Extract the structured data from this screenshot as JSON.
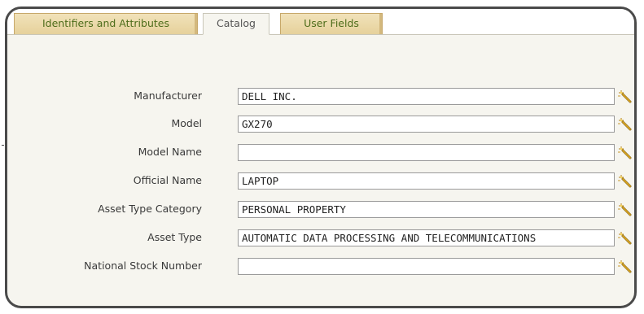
{
  "tabs": [
    {
      "label": "Identifiers and Attributes",
      "active": false
    },
    {
      "label": "Catalog",
      "active": true
    },
    {
      "label": "User Fields",
      "active": false
    }
  ],
  "fields": [
    {
      "label": "Manufacturer",
      "value": "DELL INC."
    },
    {
      "label": "Model",
      "value": "GX270"
    },
    {
      "label": "Model Name",
      "value": ""
    },
    {
      "label": "Official Name",
      "value": "LAPTOP"
    },
    {
      "label": "Asset Type Category",
      "value": "PERSONAL PROPERTY"
    },
    {
      "label": "Asset Type",
      "value": "AUTOMATIC DATA PROCESSING AND TELECOMMUNICATIONS"
    },
    {
      "label": "National Stock Number",
      "value": ""
    }
  ],
  "lookup_icon": "magic-wand-icon",
  "colors": {
    "panel_border": "#4a4a4a",
    "panel_bg": "#f6f5ef",
    "tab_inactive_bg": "#e9d6a4",
    "tab_inactive_text": "#4e6d1b",
    "wand_gold": "#d9a520"
  }
}
